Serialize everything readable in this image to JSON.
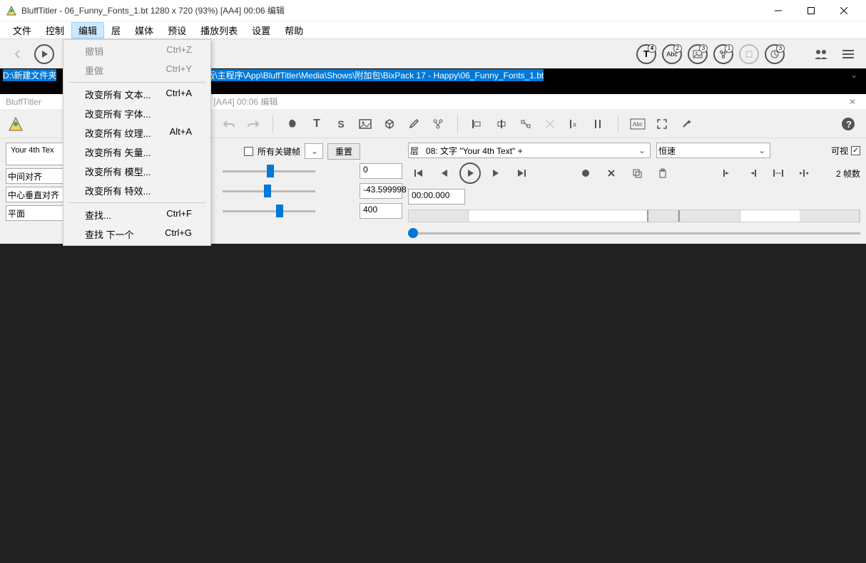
{
  "title": "BluffTitler - 06_Funny_Fonts_1.bt 1280 x 720 (93%) [AA4] 00:06 编辑",
  "menubar": [
    "文件",
    "控制",
    "编辑",
    "层",
    "媒体",
    "预设",
    "播放列表",
    "设置",
    "帮助"
  ],
  "dropdown": {
    "undo": "撤销",
    "undo_key": "Ctrl+Z",
    "redo": "重做",
    "redo_key": "Ctrl+Y",
    "change_text": "改变所有 文本...",
    "change_text_key": "Ctrl+A",
    "change_font": "改变所有 字体...",
    "change_texture": "改变所有 纹理...",
    "change_texture_key": "Alt+A",
    "change_vector": "改变所有 矢量...",
    "change_model": "改变所有 模型...",
    "change_effect": "改变所有 特效...",
    "find": "查找...",
    "find_key": "Ctrl+F",
    "find_next": "查找 下一个",
    "find_next_key": "Ctrl+G"
  },
  "badges": {
    "t": "4",
    "abc": "2",
    "img": "3",
    "fx": "1",
    "clk": "3"
  },
  "path_left": "D:\\新建文件夹",
  "path_right": "版\\主程序\\App\\BluffTitler\\Media\\Shows\\附加包\\BixPack 17 - Happy\\06_Funny_Fonts_1.bt",
  "subtitle": "BluffTitler",
  "subtitle_rest": "93%) [AA4] 00:06 编辑",
  "left": {
    "text_preview": "Your 4th Tex",
    "align_h": "中间对齐",
    "align_v": "中心垂直对齐",
    "style": "平面"
  },
  "mid": {
    "allkeys": "所有关键帧",
    "reset": "重置",
    "v1": "0",
    "v2": "-43.599998",
    "v3": "400"
  },
  "play": {
    "layer_prefix": "层",
    "layer": "08: 文字 \"Your 4th Text\" +",
    "speed": "恒速",
    "visible": "可视",
    "time": "00:00.000",
    "frames": "2 帧数"
  }
}
